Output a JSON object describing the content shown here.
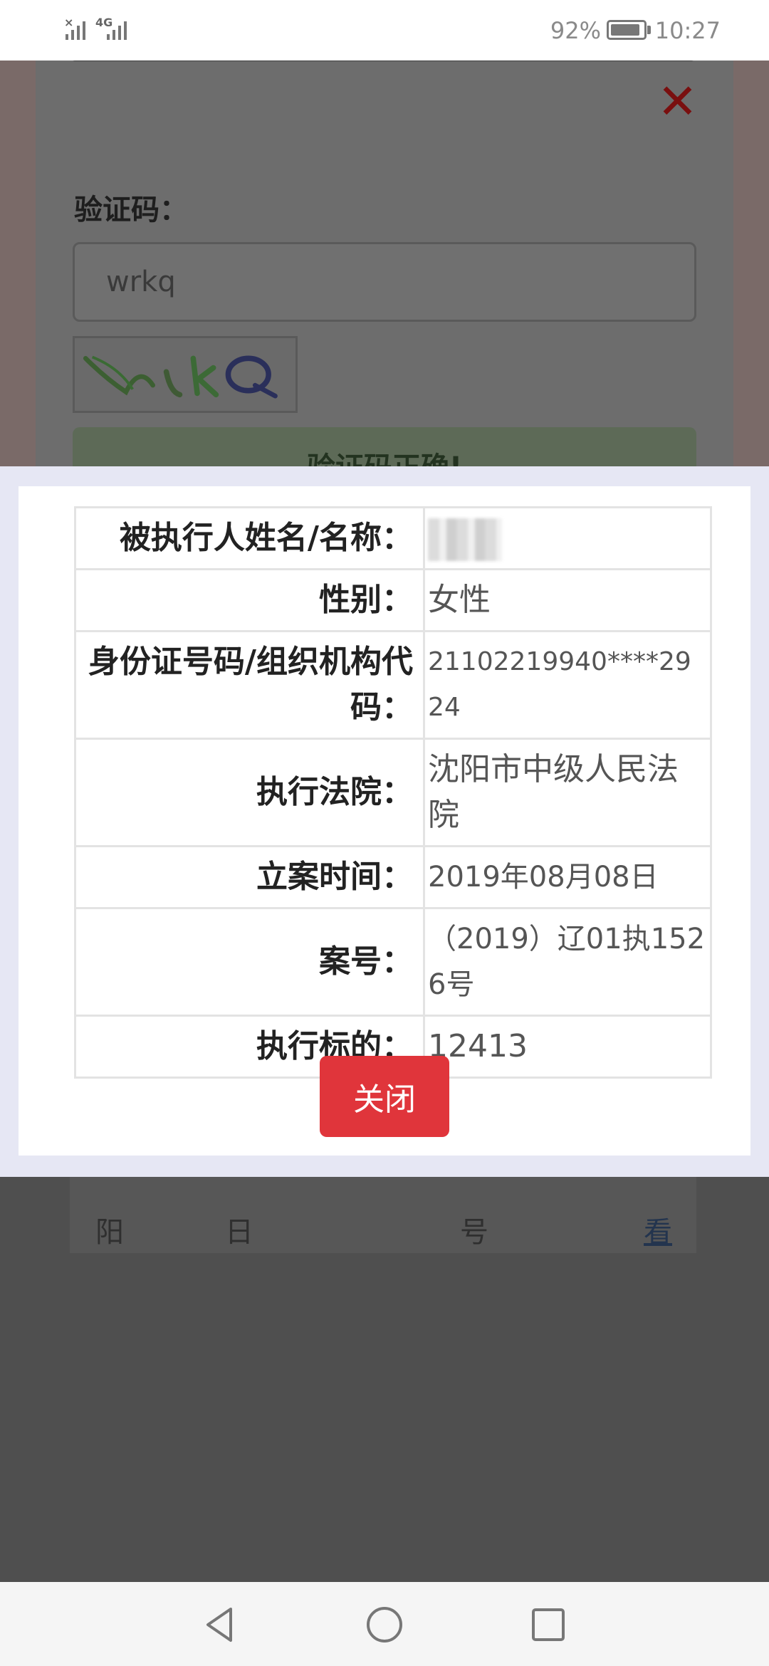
{
  "status_bar": {
    "network": "4G",
    "battery": "92%",
    "battery_level": 0.92,
    "time": "10:27"
  },
  "background_page": {
    "captcha_label": "验证码：",
    "captcha_input_value": "wrkq",
    "captcha_image_text": "WrkQ",
    "captcha_status": "验证码正确!",
    "list_row": {
      "court": "阳",
      "date": "日",
      "case_no": "号",
      "action": "看"
    }
  },
  "modal": {
    "rows": [
      {
        "label": "被执行人姓名/名称：",
        "value": ""
      },
      {
        "label": "性别：",
        "value": "女性"
      },
      {
        "label": "身份证号码/组织机构代码：",
        "value": "21102219940****2924"
      },
      {
        "label": "执行法院：",
        "value": "沈阳市中级人民法院"
      },
      {
        "label": "立案时间：",
        "value": "2019年08月08日"
      },
      {
        "label": "案号：",
        "value": "（2019）辽01执1526号"
      },
      {
        "label": "执行标的：",
        "value": "12413"
      }
    ],
    "close_label": "关闭"
  },
  "colors": {
    "close_button": "#e0353b",
    "close_x": "#7a0f0f",
    "modal_band": "#e6e7f4"
  },
  "icons": {
    "nav": [
      "back-icon",
      "home-icon",
      "recent-apps-icon"
    ]
  }
}
